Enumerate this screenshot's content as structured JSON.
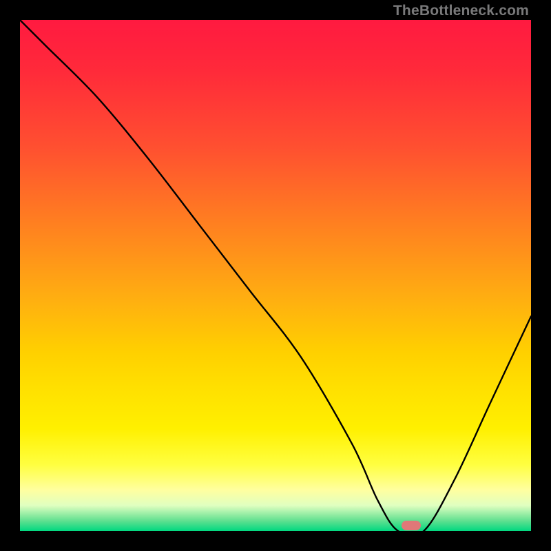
{
  "watermark": "TheBottleneck.com",
  "chart_data": {
    "type": "line",
    "title": "",
    "xlabel": "",
    "ylabel": "",
    "xlim": [
      0,
      1
    ],
    "ylim": [
      0,
      1
    ],
    "x": [
      0.0,
      0.05,
      0.15,
      0.25,
      0.35,
      0.45,
      0.55,
      0.65,
      0.7,
      0.74,
      0.79,
      0.85,
      0.92,
      1.0
    ],
    "values": [
      1.0,
      0.95,
      0.85,
      0.73,
      0.6,
      0.47,
      0.34,
      0.17,
      0.06,
      0.0,
      0.0,
      0.1,
      0.25,
      0.42
    ],
    "marker": {
      "x": 0.765,
      "y": 0.005
    },
    "gradient_stops": [
      {
        "pos": 0.0,
        "color": "#ff1a40"
      },
      {
        "pos": 0.25,
        "color": "#ff5030"
      },
      {
        "pos": 0.55,
        "color": "#ffb010"
      },
      {
        "pos": 0.8,
        "color": "#fff000"
      },
      {
        "pos": 0.95,
        "color": "#e0ffc0"
      },
      {
        "pos": 1.0,
        "color": "#00d880"
      }
    ]
  }
}
